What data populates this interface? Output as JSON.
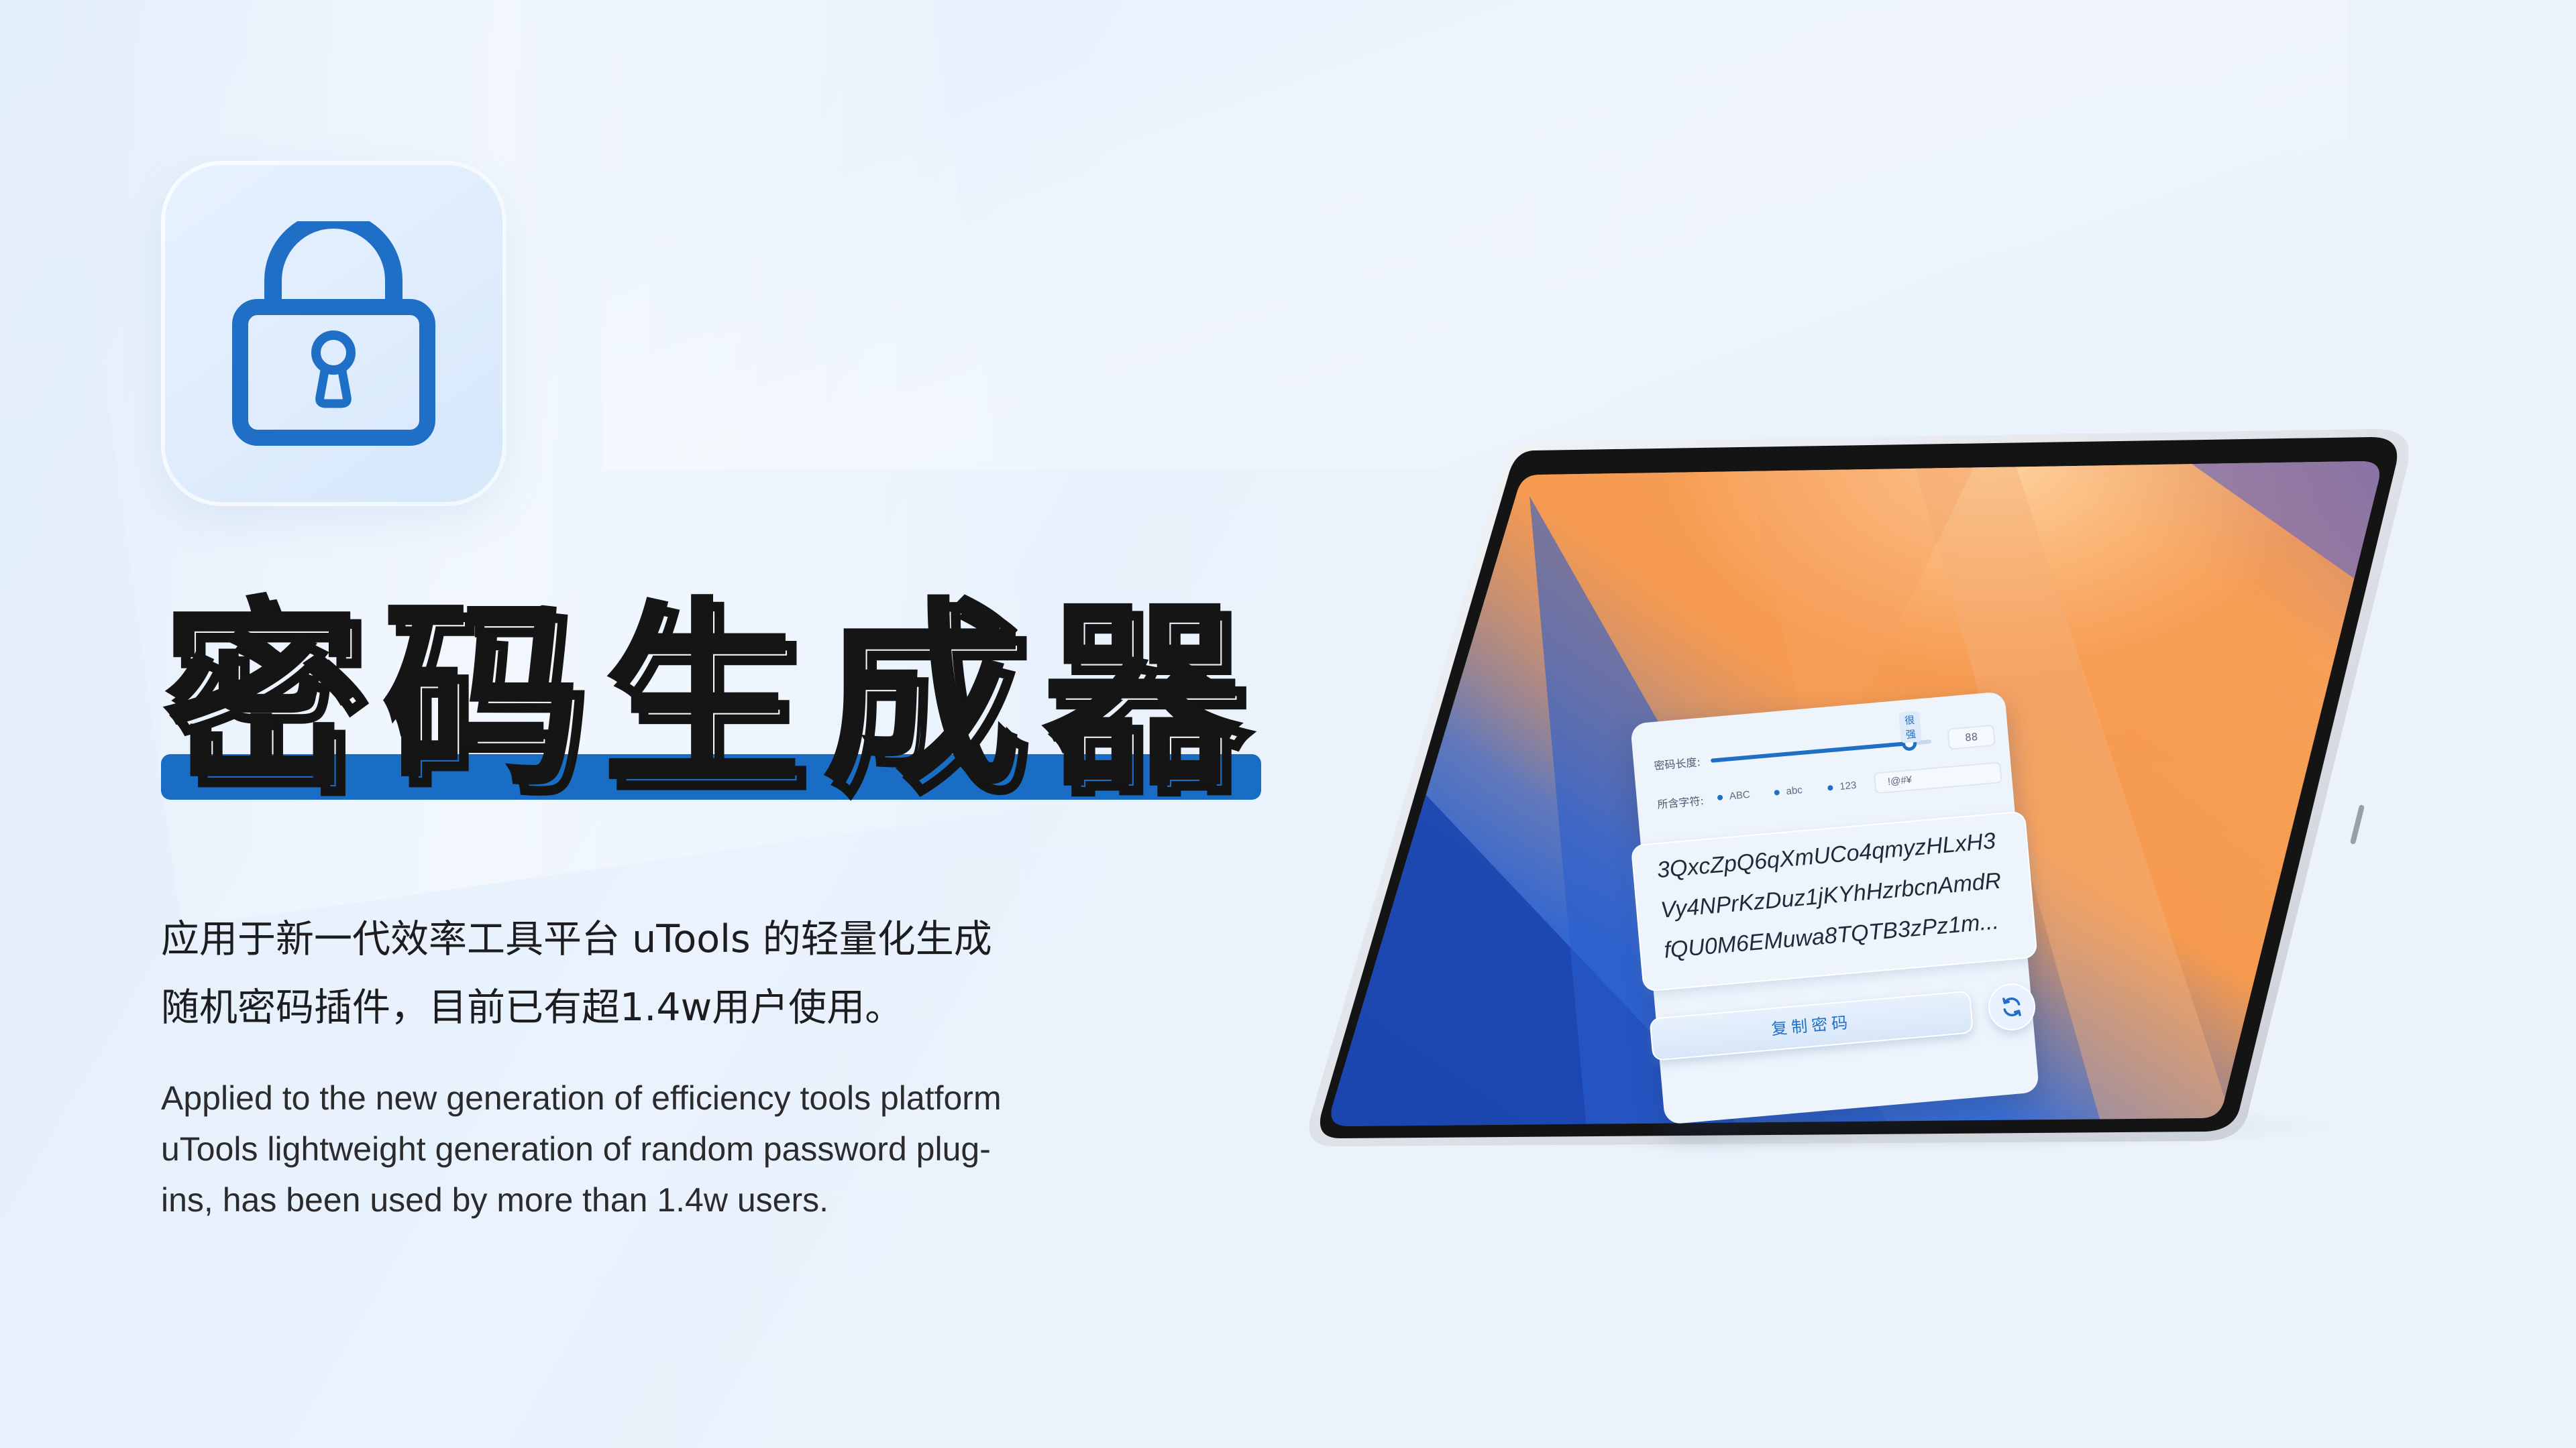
{
  "colors": {
    "accent": "#1a6dc4",
    "title": "#151515",
    "background": "#e6f0fb"
  },
  "app_icon": {
    "icon": "lock-icon"
  },
  "headline": {
    "title": "密码生成器"
  },
  "description": {
    "chinese_line1": "应用于新一代效率工具平台 uTools 的轻量化生成",
    "chinese_line2": "随机密码插件，目前已有超1.4w用户使用。",
    "english_line1": "Applied to the new generation of efficiency tools platform",
    "english_line2": "uTools lightweight generation of random password plug-",
    "english_line3": "ins, has been used by more than 1.4w users."
  },
  "plugin_ui": {
    "length_label": "密码长度:",
    "strength_badge": "很强",
    "length_value": "88",
    "length_fraction": 0.9,
    "chars_label": "所含字符:",
    "options": [
      "ABC",
      "abc",
      "123"
    ],
    "symbols_value": "!@#¥",
    "password_lines": [
      "3QxcZpQ6qXmUCo4qmyzHLxH3",
      "Vy4NPrKzDuz1jKYhHzrbcnAmdR",
      "fQU0M6EMuwa8TQTB3zPz1m..."
    ],
    "copy_button": "复制密码",
    "refresh_icon": "refresh-icon"
  }
}
